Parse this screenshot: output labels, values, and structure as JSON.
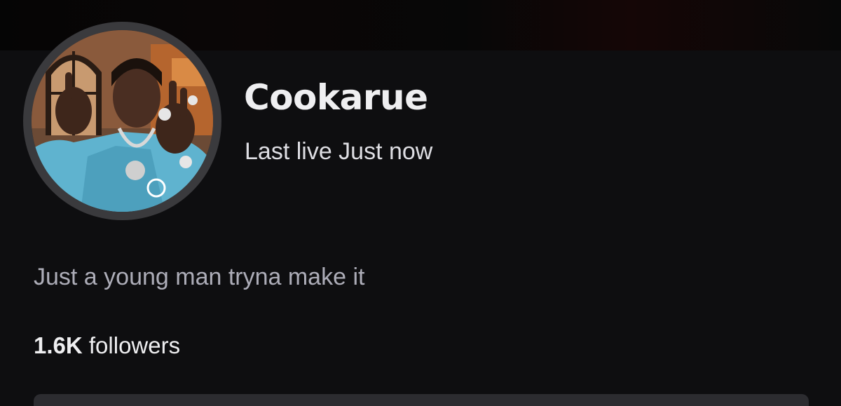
{
  "channel": {
    "name": "Cookarue",
    "last_live": "Last live Just now",
    "bio": "Just a young man tryna make it",
    "followers": {
      "count": "1.6K",
      "label": "followers"
    }
  },
  "colors": {
    "background": "#0e0e10",
    "text_primary": "#efeff1",
    "text_secondary": "#adadb8",
    "avatar_ring": "#3a3a3d"
  }
}
